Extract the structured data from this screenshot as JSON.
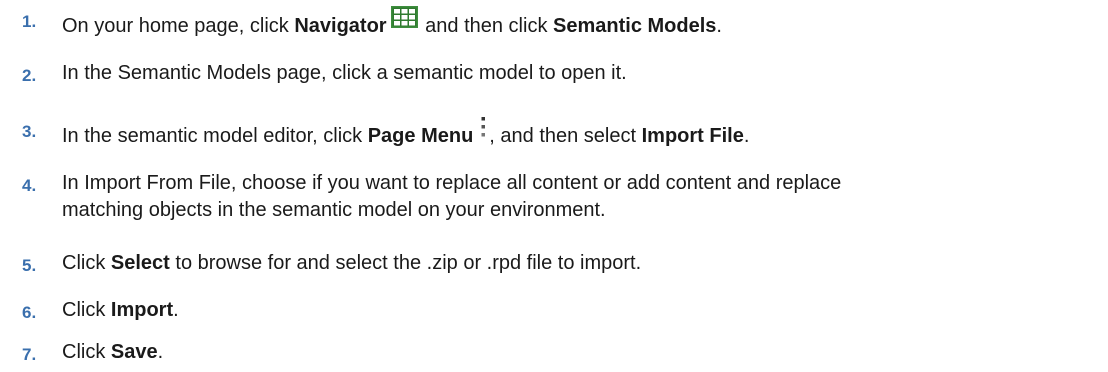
{
  "steps": [
    {
      "number": "1.",
      "parts": [
        "On your home page, click ",
        "Navigator",
        " and then click ",
        "Semantic Models",
        "."
      ],
      "icon": "navigator-grid-icon"
    },
    {
      "number": "2.",
      "parts": [
        "In the Semantic Models page, click a semantic model to open it."
      ]
    },
    {
      "number": "3.",
      "parts": [
        "In the semantic model editor, click ",
        "Page Menu",
        ", and then select ",
        "Import File",
        "."
      ],
      "icon": "page-menu-kebab-icon"
    },
    {
      "number": "4.",
      "lines": [
        "In Import From File, choose if you want to replace all content or add content and replace",
        "matching objects in the semantic model on your environment."
      ]
    },
    {
      "number": "5.",
      "parts": [
        "Click ",
        "Select",
        " to browse for and select the .zip or .rpd file to import."
      ]
    },
    {
      "number": "6.",
      "parts": [
        "Click ",
        "Import",
        "."
      ]
    },
    {
      "number": "7.",
      "parts": [
        "Click ",
        "Save",
        "."
      ]
    }
  ],
  "colors": {
    "step_number": "#3a6fad",
    "text": "#1a1a1a",
    "navigator_icon_bg": "#3e8e3e",
    "navigator_icon_grid": "#ffffff"
  }
}
